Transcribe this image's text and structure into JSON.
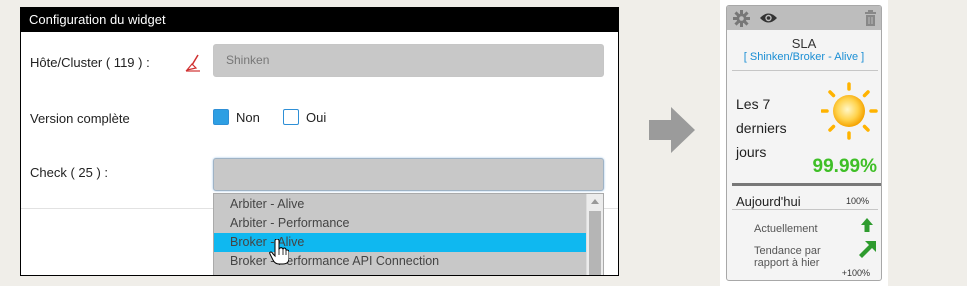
{
  "dialog": {
    "title": "Configuration du widget",
    "host_label": "Hôte/Cluster ( 119 ) :",
    "host_value": "Shinken",
    "version_label": "Version complète",
    "option_no": "Non",
    "option_yes": "Oui",
    "version_selected": "Non",
    "check_label": "Check ( 25 ) :",
    "check_value": "",
    "dropdown_items": [
      "Arbiter - Alive",
      "Arbiter - Performance",
      "Broker - Alive",
      "Broker - Performance API Connection"
    ],
    "dropdown_selected": "Broker - Alive"
  },
  "widget": {
    "title": "SLA",
    "subtitle": "[ Shinken/Broker - Alive ]",
    "period_label": "Les 7 derniers jours",
    "percentage": "99.99%",
    "today_label": "Aujourd'hui",
    "today_value": "100%",
    "current_label": "Actuellement",
    "trend_label": "Tendance par rapport à hier",
    "trend_value": "+100%",
    "colors": {
      "good": "#3fbf27",
      "accent": "#1a8ed4",
      "sun": "#ffb300"
    },
    "icons": [
      "gear-icon",
      "eye-icon",
      "trash-icon",
      "sun-weather-icon",
      "arrow-up-icon",
      "arrow-up-right-icon"
    ]
  },
  "arrow_icon": "right-arrow-icon"
}
